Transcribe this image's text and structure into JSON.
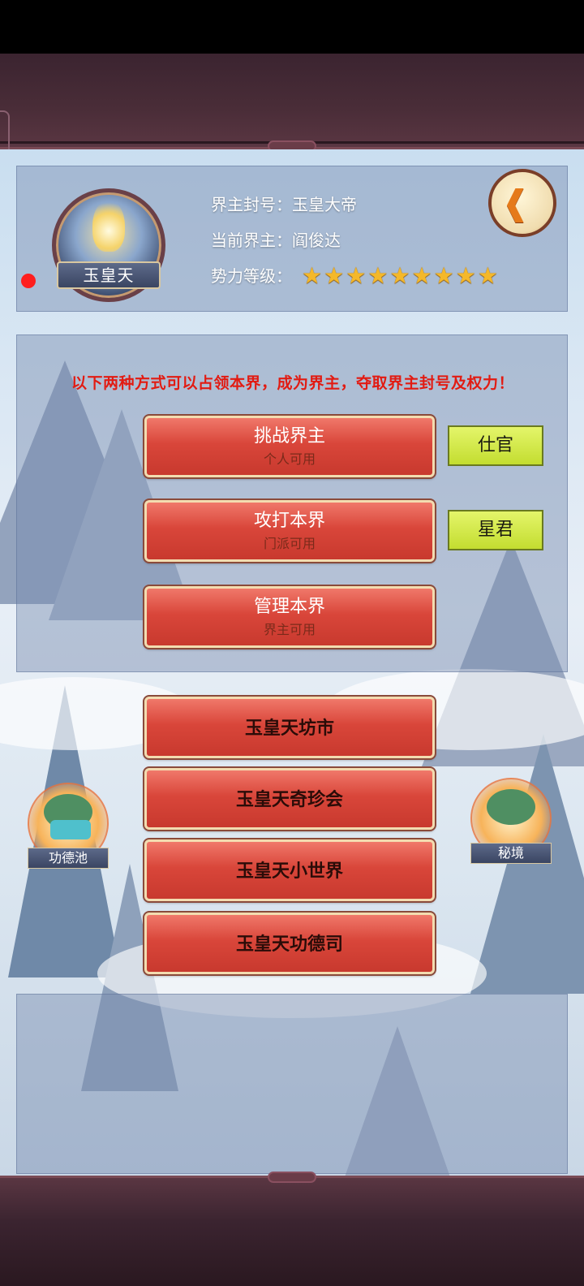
{
  "realm": {
    "emblem_name": "玉皇天",
    "title_label": "界主封号：",
    "title_value": "玉皇大帝",
    "lord_label": "当前界主：",
    "lord_value": "阎俊达",
    "power_label": "势力等级：",
    "power_stars": 9
  },
  "notice": "以下两种方式可以占领本界，成为界主，夺取界主封号及权力！",
  "actions": [
    {
      "title": "挑战界主",
      "sub": "个人可用",
      "tag": "仕官"
    },
    {
      "title": "攻打本界",
      "sub": "门派可用",
      "tag": "星君"
    },
    {
      "title": "管理本界",
      "sub": "界主可用"
    }
  ],
  "menu": [
    {
      "label": "玉皇天坊市"
    },
    {
      "label": "玉皇天奇珍会"
    },
    {
      "label": "玉皇天小世界"
    },
    {
      "label": "玉皇天功德司"
    }
  ],
  "side": {
    "left_label": "功德池",
    "right_label": "秘境"
  },
  "icons": {
    "back": "back-arrow-icon",
    "star": "star-icon"
  },
  "colors": {
    "notice": "#e21b12",
    "button_red": "#d9463a",
    "tag_green": "#c3dd30",
    "star_gold": "#f4b82a"
  }
}
